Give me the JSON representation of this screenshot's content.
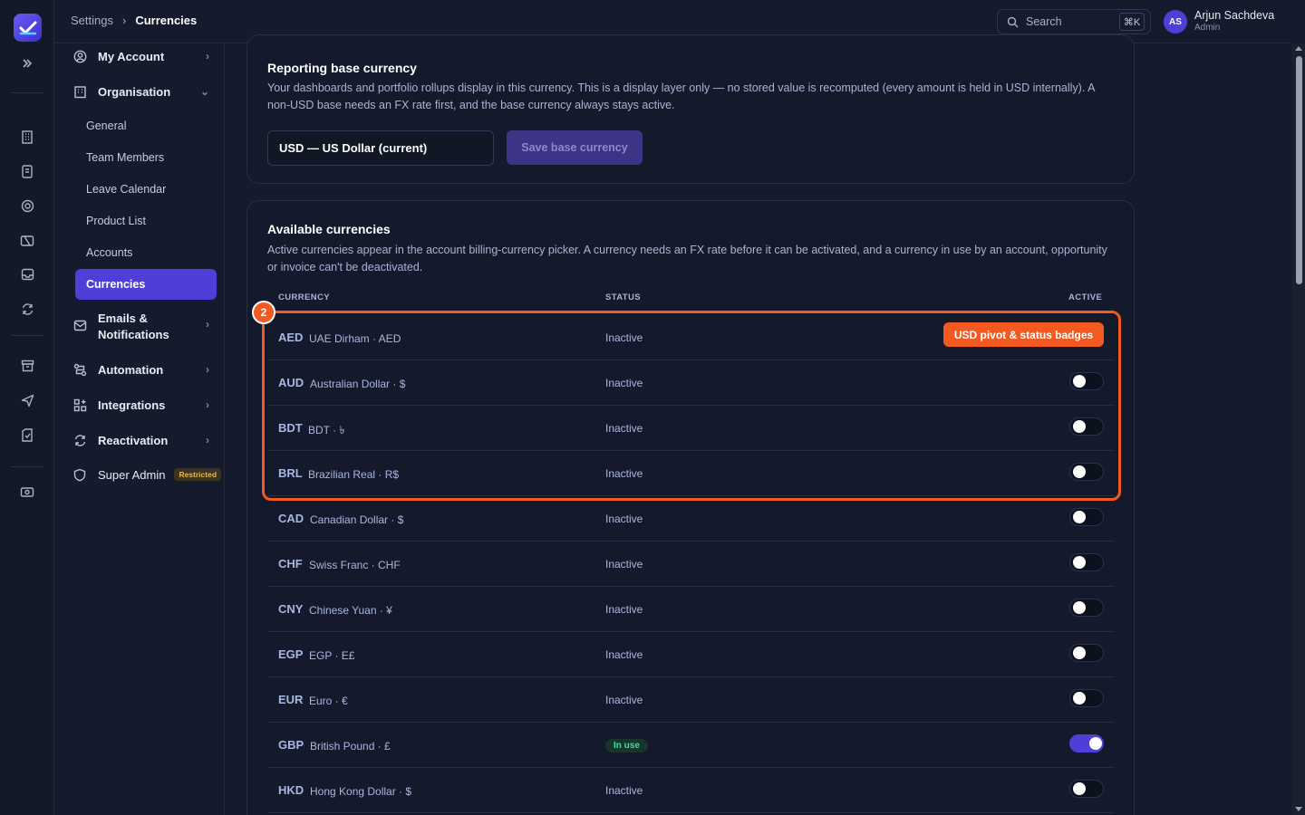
{
  "breadcrumb": {
    "root": "Settings",
    "separator": "›",
    "current": "Currencies"
  },
  "search": {
    "placeholder": "Search",
    "shortcut": "⌘K"
  },
  "user": {
    "initials": "AS",
    "name": "Arjun Sachdeva",
    "role": "Admin"
  },
  "sidebar": {
    "my_account": "My Account",
    "organisation": "Organisation",
    "sub_items": [
      "General",
      "Team Members",
      "Leave Calendar",
      "Product List",
      "Accounts",
      "Currencies"
    ],
    "emails_line1": "Emails &",
    "emails_line2": "Notifications",
    "automation": "Automation",
    "integrations": "Integrations",
    "reactivation": "Reactivation",
    "super_admin": "Super Admin",
    "restricted_badge": "Restricted"
  },
  "base_currency": {
    "title": "Reporting base currency",
    "description": "Your dashboards and portfolio rollups display in this currency. This is a display layer only — no stored value is recomputed (every amount is held in USD internally). A non-USD base needs an FX rate first, and the base currency always stays active.",
    "selected": "USD — US Dollar (current)",
    "save_label": "Save base currency"
  },
  "available": {
    "title": "Available currencies",
    "description": "Active currencies appear in the account billing-currency picker. A currency needs an FX rate before it can be activated, and a currency in use by an account, opportunity or invoice can't be deactivated.",
    "headers": {
      "currency": "CURRENCY",
      "status": "STATUS",
      "active": "ACTIVE"
    },
    "rows": [
      {
        "code": "AED",
        "name": "UAE Dirham · AED",
        "status": "Inactive",
        "active": false
      },
      {
        "code": "AUD",
        "name": "Australian Dollar · $",
        "status": "Inactive",
        "active": false
      },
      {
        "code": "BDT",
        "name": "BDT · ৳",
        "status": "Inactive",
        "active": false
      },
      {
        "code": "BRL",
        "name": "Brazilian Real · R$",
        "status": "Inactive",
        "active": false
      },
      {
        "code": "CAD",
        "name": "Canadian Dollar · $",
        "status": "Inactive",
        "active": false
      },
      {
        "code": "CHF",
        "name": "Swiss Franc · CHF",
        "status": "Inactive",
        "active": false
      },
      {
        "code": "CNY",
        "name": "Chinese Yuan · ¥",
        "status": "Inactive",
        "active": false
      },
      {
        "code": "EGP",
        "name": "EGP · E£",
        "status": "Inactive",
        "active": false
      },
      {
        "code": "EUR",
        "name": "Euro · €",
        "status": "Inactive",
        "active": false
      },
      {
        "code": "GBP",
        "name": "British Pound · £",
        "status": "In use",
        "active": true
      },
      {
        "code": "HKD",
        "name": "Hong Kong Dollar · $",
        "status": "Inactive",
        "active": false
      }
    ]
  },
  "annotation": {
    "number": "2",
    "label": "USD pivot & status badges",
    "color": "#f25a22"
  },
  "colors": {
    "accent": "#4f3fd8",
    "in_use": "#3ee09a",
    "restricted": "#e7b94a"
  }
}
